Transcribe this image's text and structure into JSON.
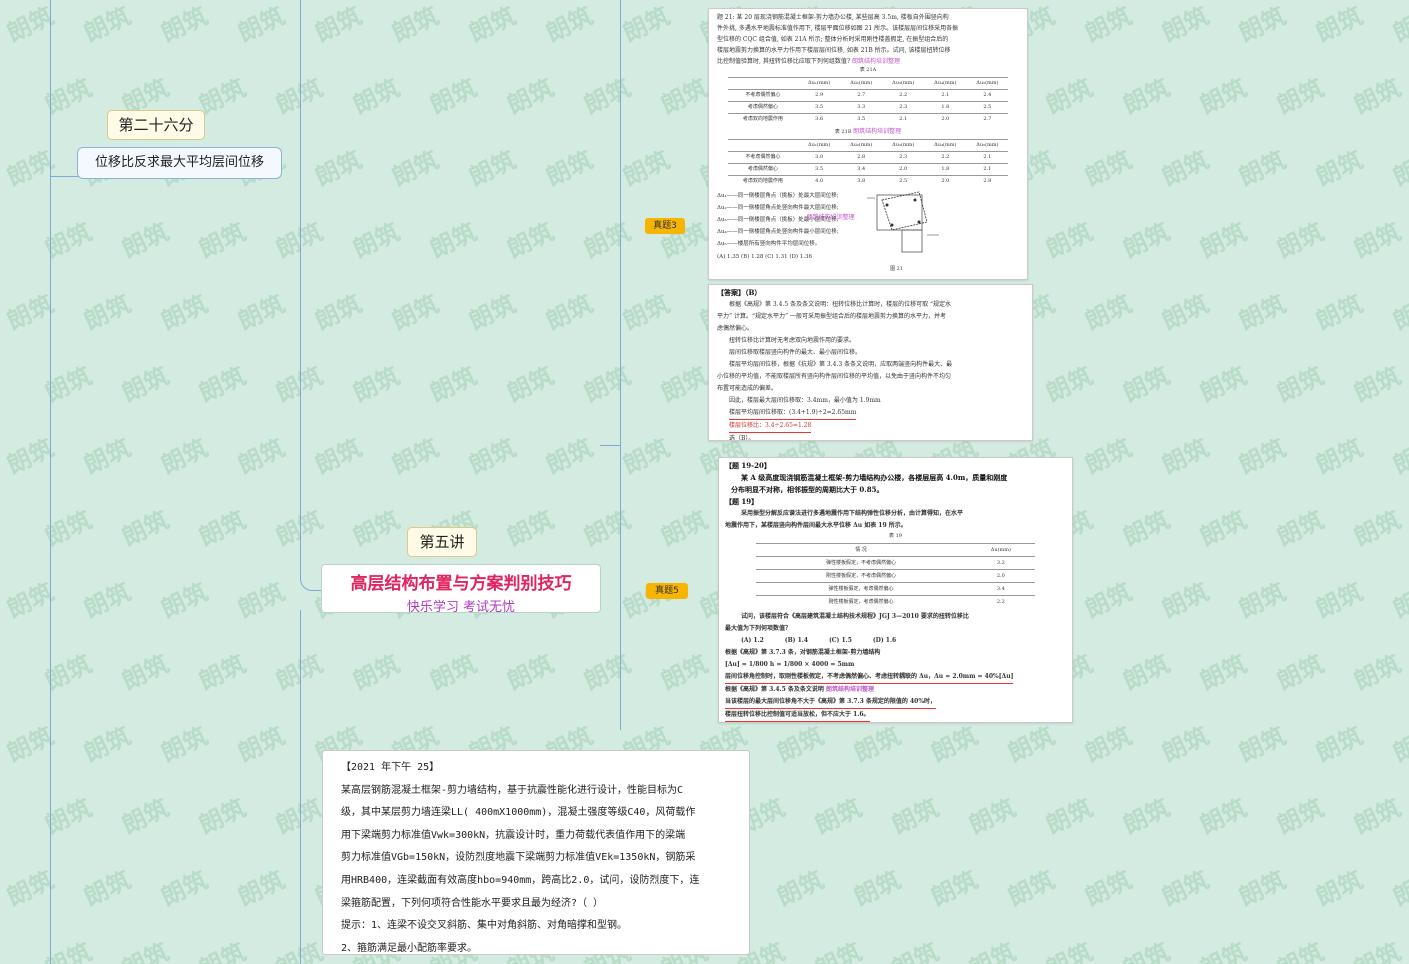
{
  "mindmap": {
    "node_26": "第二十六分",
    "node_displacement": "位移比反求最大平均层间位移",
    "node_lecture": "第五讲",
    "main_title": "高层结构布置与方案判别技巧",
    "main_subtitle": "快乐学习  考试无忧",
    "tag_zt3": "真题3",
    "tag_zt5": "真题5"
  },
  "watermark": "朗筑",
  "doc1": {
    "lines": [
      "题 21: 某 20 层现浇钢筋混凝土框架-剪力墙办公楼, 某些层高 3.5m, 楼板自外围竖向构",
      "件外挑, 多遇水平地震标准值作用下, 楼层平面位移如图 21 所示。该楼层层间位移采用各振",
      "型位移的 CQC 组合值, 如表 21A 所示; 整体分析时采用刚性楼盖假定, 在振型组合后的",
      "楼层地震剪力换算的水平力作用下楼层层间位移, 如表 21B 所示。试问, 该楼层扭转位移",
      "比控制值验算时, 其扭转位移比应取下列何组数值?"
    ],
    "stamp": "朗筑结构培训整理",
    "t21a_caption": "表 21A",
    "t21b_caption": "表 21B",
    "headers": [
      "",
      "Δu₁(mm)",
      "Δu₂(mm)",
      "Δu₃(mm)",
      "Δu₄(mm)",
      "Δu₅(mm)"
    ],
    "t21a_rows": [
      [
        "不考虑偶然偏心",
        "2.9",
        "2.7",
        "2.2",
        "2.1",
        "2.4"
      ],
      [
        "考虑偶然偏心",
        "3.5",
        "3.3",
        "2.3",
        "1.8",
        "2.5"
      ],
      [
        "考虑双向地震作用",
        "3.6",
        "3.5",
        "2.1",
        "2.0",
        "2.7"
      ]
    ],
    "t21b_rows": [
      [
        "不考虑偶然偏心",
        "3.0",
        "2.8",
        "2.3",
        "2.2",
        "2.1"
      ],
      [
        "考虑偶然偏心",
        "3.5",
        "3.4",
        "2.0",
        "1.8",
        "2.1"
      ],
      [
        "考虑双向地震作用",
        "4.0",
        "3.8",
        "2.5",
        "2.0",
        "2.8"
      ]
    ],
    "notes": [
      "Δu₁——同一侧楼层角点（挑板）处最大层间位移;",
      "Δu₂——同一侧楼层角点处竖向构件最大层间位移;",
      "Δu₃——同一侧楼层角点（挑板）处最小层间位移;",
      "Δu₄——同一侧楼层角点处竖向构件最小层间位移;",
      "Δu₅——楼层所有竖向构件平均层间位移。"
    ],
    "options": "(A) 1.35  (B) 1.28  (C) 1.31  (D) 1.36",
    "figure_caption": "图 21"
  },
  "doc2": {
    "lines": [
      "【答案】（B）",
      "根据《高规》第 3.4.5 条及条文说明：扭转位移比计算时，楼层的位移可取 “规定水",
      "平力” 计算。“规定水平力” 一般可采用振型组合后的楼层地震剪力换算的水平力，并考",
      "虑偶然偏心。",
      "扭转位移比计算时无考虑双向地震作用的要求。",
      "层间位移取楼层竖向构件的最大、最小层间位移。",
      "楼层平均层间位移，根据《抗规》第 3.4.3 条条文说明，应取两端竖向构件最大、最",
      "小位移的平均值，不能取楼层所有竖向构件层间位移的平均值，以免由于竖向构件不均匀",
      "布置可能造成的偏差。",
      "因此，楼层最大层间位移取：3.4mm，最小值为 1.9mm",
      "楼层平均层间位移取：(3.4+1.9)÷2=2.65mm",
      "楼层位移比：3.4÷2.65=1.28",
      "选（B）。"
    ]
  },
  "doc3": {
    "title": "【题 19-20】",
    "lines": [
      "某 A 级高度现浇钢筋混凝土框架-剪力墙结构办公楼，各楼层层高 4.0m，质量和刚度",
      "分布明显不对称，相邻振型的周期比大于 0.85。",
      "【题 19】",
      "采用振型分解反应谱法进行多遇地震作用下结构弹性位移分析，由计算得知，在水平",
      "地震作用下，某楼层竖向构件层间最大水平位移 Δu 如表 19 所示。"
    ],
    "table_caption": "表 19",
    "table_headers": [
      "情  况",
      "Δu(mm)"
    ],
    "table_rows": [
      [
        "弹性楼板假定，不考虑偶然偏心",
        "3.2"
      ],
      [
        "刚性楼板假定，不考虑偶然偏心",
        "2.0"
      ],
      [
        "弹性楼板假定，考虑偶然偏心",
        "3.4"
      ],
      [
        "刚性楼板假定，考虑偶然偏心",
        "2.2"
      ]
    ],
    "question": [
      "试问，该楼层符合《高层建筑混凝土结构技术规程》JGJ 3—2010 要求的扭转位移比",
      "最大值为下列何项数值？"
    ],
    "options": [
      "(A) 1.2",
      "(B) 1.4",
      "(C) 1.5",
      "(D) 1.6"
    ],
    "answer": [
      "根据《高规》第 3.7.3 条，对钢筋混凝土框架-剪力墙结构",
      "[Δu] = 1/800 h = 1/800 × 4000 = 5mm",
      "层间位移角控制时，取刚性楼板假定，不考虑偶然偏心、考虑扭转耦联的 Δu，Δu = 2.0mm = 40%[Δu]",
      "根据《高规》第 3.4.5 条及条文说明",
      "当该楼层的最大层间位移角不大于《高规》第 3.7.3 条规定的限值的 40%时，",
      "楼层扭转位移比控制值可适当放松，但不应大于 1.6。"
    ]
  },
  "q2021": {
    "lines": [
      "【2021 年下午 25】",
      "某高层钢筋混凝土框架-剪力墙结构，基于抗震性能化进行设计，性能目标为C",
      "级，其中某层剪力墙连梁LL( 400mX1000mm)，混凝土强度等级C40，风荷载作",
      "用下梁端剪力标准值Vwk=300kN，抗震设计时，重力荷载代表值作用下的梁端",
      "剪力标准值VGb=150kN，设防烈度地震下梁端剪力标准值VEk=1350kN，钢筋采",
      "用HRB400，连梁截面有效高度hbo=940mm，跨高比2.0，试问，设防烈度下，连",
      "梁箍筋配置，下列何项符合性能水平要求且最为经济?（        ）",
      "提示：1、连梁不设交叉斜筋、集中对角斜筋、对角暗撑和型钢。",
      "2、箍筋满足最小配筋率要求。"
    ]
  }
}
